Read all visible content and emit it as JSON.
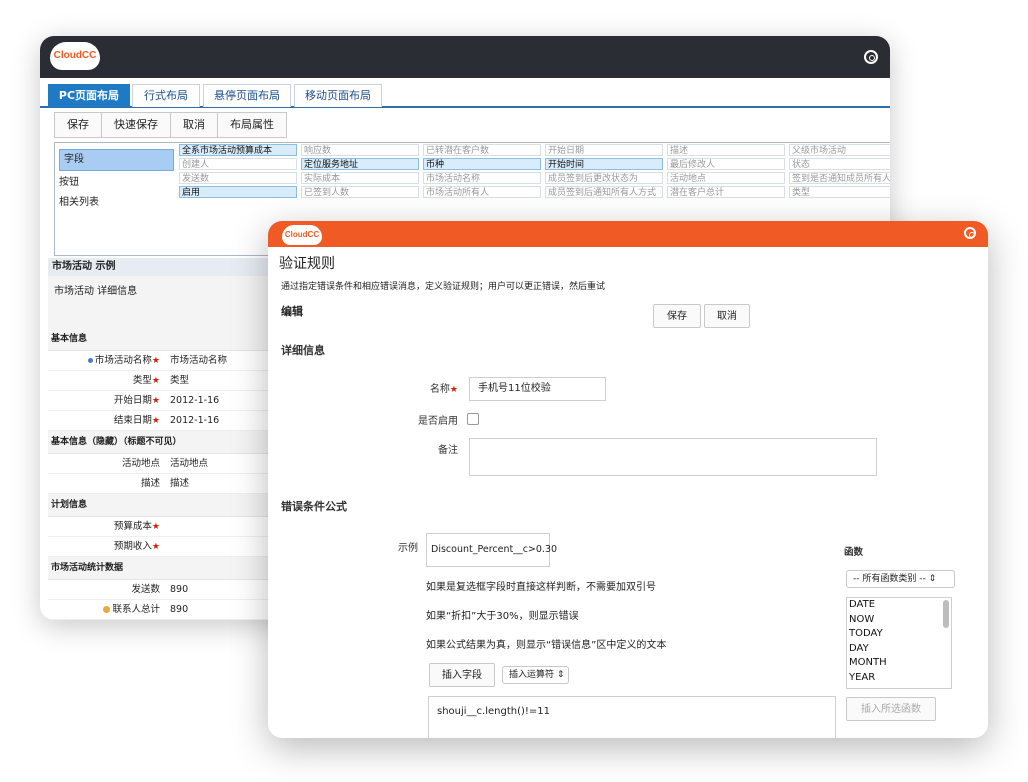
{
  "layout_editor": {
    "logo_text": "CloudCC",
    "tabs": [
      "PC页面布局",
      "行式布局",
      "悬停页面布局",
      "移动页面布局"
    ],
    "toolbar": [
      "保存",
      "快速保存",
      "取消",
      "布局属性"
    ],
    "palette_items": [
      "字段",
      "按钮",
      "相关列表"
    ],
    "field_grid": [
      [
        {
          "t": "全系市场活动预算成本",
          "on": true
        },
        {
          "t": "响应数",
          "on": false
        },
        {
          "t": "已转潜在客户数",
          "on": false
        },
        {
          "t": "开始日期",
          "on": false
        },
        {
          "t": "描述",
          "on": false
        },
        {
          "t": "父级市场活动",
          "on": false
        }
      ],
      [
        {
          "t": "创建人",
          "on": false
        },
        {
          "t": "定位服务地址",
          "on": true
        },
        {
          "t": "币种",
          "on": true
        },
        {
          "t": "开始时间",
          "on": true
        },
        {
          "t": "最后修改人",
          "on": false
        },
        {
          "t": "状态",
          "on": false
        }
      ],
      [
        {
          "t": "发送数",
          "on": false
        },
        {
          "t": "实际成本",
          "on": false
        },
        {
          "t": "市场活动名称",
          "on": false
        },
        {
          "t": "成员签到后更改状态为",
          "on": false
        },
        {
          "t": "活动地点",
          "on": false
        },
        {
          "t": "签到是否通知成员所有人",
          "on": false
        }
      ],
      [
        {
          "t": "启用",
          "on": true
        },
        {
          "t": "已签到人数",
          "on": false
        },
        {
          "t": "市场活动所有人",
          "on": false
        },
        {
          "t": "成员签到后通知所有人方式",
          "on": false
        },
        {
          "t": "潜在客户总计",
          "on": false
        },
        {
          "t": "类型",
          "on": false
        }
      ]
    ],
    "detail": {
      "header": "市场活动 示例",
      "box_text": "市场活动 详细信息",
      "sections": [
        {
          "title": "基本信息",
          "rows": [
            {
              "label": "市场活动名称",
              "value": "市场活动名称",
              "required": true,
              "marker": "bullet"
            },
            {
              "label": "类型",
              "value": "类型",
              "required": true,
              "marker": ""
            },
            {
              "label": "开始日期",
              "value": "2012-1-16",
              "required": true,
              "marker": ""
            },
            {
              "label": "结束日期",
              "value": "2012-1-16",
              "required": true,
              "marker": ""
            }
          ]
        },
        {
          "title": "基本信息（隐藏）（标题不可见）",
          "rows": [
            {
              "label": "活动地点",
              "value": "活动地点",
              "required": false,
              "marker": ""
            },
            {
              "label": "描述",
              "value": "描述",
              "required": false,
              "marker": ""
            }
          ]
        },
        {
          "title": "计划信息",
          "rows": [
            {
              "label": "预算成本",
              "value": "",
              "required": true,
              "marker": ""
            },
            {
              "label": "预期收入",
              "value": "",
              "required": true,
              "marker": ""
            }
          ]
        },
        {
          "title": "市场活动统计数据",
          "rows": [
            {
              "label": "发送数",
              "value": "890",
              "required": false,
              "marker": ""
            },
            {
              "label": "联系人总计",
              "value": "890",
              "required": false,
              "marker": "warn"
            }
          ]
        }
      ]
    }
  },
  "validation_rule": {
    "logo_text": "CloudCC",
    "title": "验证规则",
    "description": "通过指定错误条件和相应错误消息，定义验证规则；用户可以更正错误，然后重试",
    "edit_label": "编辑",
    "save_label": "保存",
    "cancel_label": "取消",
    "detail_section": "详细信息",
    "name_label": "名称",
    "name_value": "手机号11位校验",
    "active_label": "是否启用",
    "notes_label": "备注",
    "notes_value": "",
    "formula_section": "错误条件公式",
    "example_label": "示例",
    "example_value": "Discount_Percent__c>0.30",
    "hints": [
      "如果是复选框字段时直接这样判断，不需要加双引号",
      "如果“折扣”大于30%，则显示错误",
      "如果公式结果为真，则显示“错误信息”区中定义的文本"
    ],
    "insert_field_label": "插入字段",
    "insert_operator_label": "插入运算符 ⇕",
    "formula_value": "shouji__c.length()!=11",
    "functions_label": "函数",
    "function_category_select": "-- 所有函数类别 -- ⇕",
    "functions": [
      "DATE",
      "NOW",
      "TODAY",
      "DAY",
      "MONTH",
      "YEAR"
    ],
    "insert_selected_function_label": "插入所选函数"
  }
}
